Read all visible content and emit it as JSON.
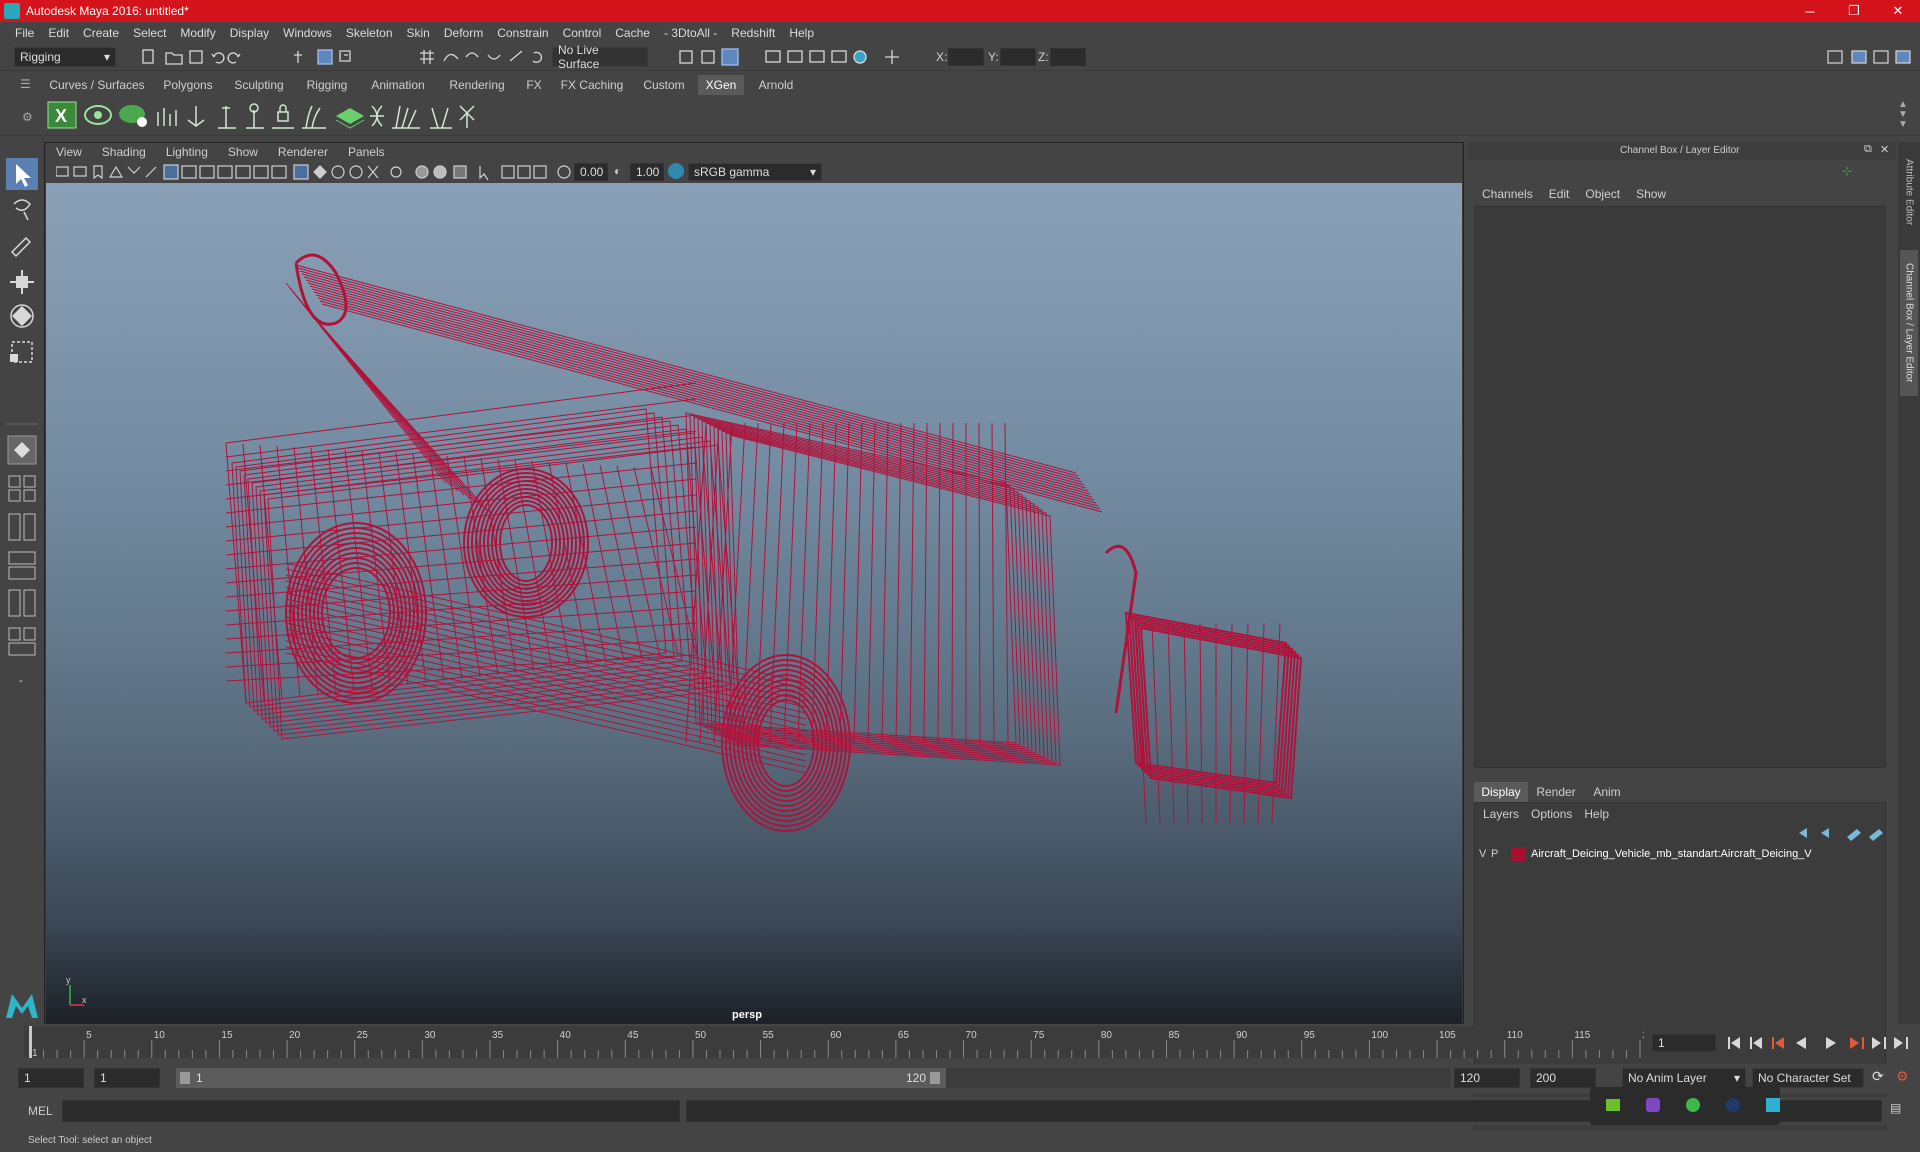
{
  "window": {
    "title": "Autodesk Maya 2016: untitled*",
    "controls": [
      "─",
      "❐",
      "✕"
    ]
  },
  "menubar": [
    "File",
    "Edit",
    "Create",
    "Select",
    "Modify",
    "Display",
    "Windows",
    "Skeleton",
    "Skin",
    "Deform",
    "Constrain",
    "Control",
    "Cache",
    "- 3DtoAll -",
    "Redshift",
    "Help"
  ],
  "statusline": {
    "menuset": "Rigging",
    "live_surface": "No Live Surface",
    "x_label": "X:",
    "y_label": "Y:",
    "z_label": "Z:"
  },
  "shelf": {
    "tabs": [
      "Curves / Surfaces",
      "Polygons",
      "Sculpting",
      "Rigging",
      "Animation",
      "Rendering",
      "FX",
      "FX Caching",
      "Custom",
      "XGen",
      "Arnold"
    ],
    "active_tab": "XGen"
  },
  "viewport": {
    "menus": [
      "View",
      "Shading",
      "Lighting",
      "Show",
      "Renderer",
      "Panels"
    ],
    "exposure": "0.00",
    "gamma": "1.00",
    "color_space": "sRGB gamma",
    "camera_label": "persp",
    "axis_y": "y",
    "axis_x": "x",
    "wire_color": "#b0123a"
  },
  "channelbox": {
    "title": "Channel Box / Layer Editor",
    "menus": [
      "Channels",
      "Edit",
      "Object",
      "Show"
    ]
  },
  "layer_editor": {
    "tabs": [
      "Display",
      "Render",
      "Anim"
    ],
    "active_tab": "Display",
    "menus": [
      "Layers",
      "Options",
      "Help"
    ],
    "layers": [
      {
        "v": "V",
        "p": "P",
        "color": "#a8102e",
        "name": "Aircraft_Deicing_Vehicle_mb_standart:Aircraft_Deicing_V"
      }
    ]
  },
  "side_tabs": [
    "Attribute Editor",
    "Channel Box / Layer Editor"
  ],
  "timeline": {
    "ticks": [
      "1",
      "5",
      "10",
      "15",
      "20",
      "25",
      "30",
      "35",
      "40",
      "45",
      "50",
      "55",
      "60",
      "65",
      "70",
      "75",
      "80",
      "85",
      "90",
      "95",
      "100",
      "105",
      "110",
      "115",
      "120"
    ],
    "current_frame": "1"
  },
  "range": {
    "start": "1",
    "playback_start": "1",
    "slider_start": "1",
    "slider_end": "120",
    "playback_end": "120",
    "end": "200",
    "anim_layer": "No Anim Layer",
    "char_set": "No Character Set"
  },
  "cmdline": {
    "lang": "MEL"
  },
  "helpline": {
    "text": "Select Tool: select an object"
  }
}
